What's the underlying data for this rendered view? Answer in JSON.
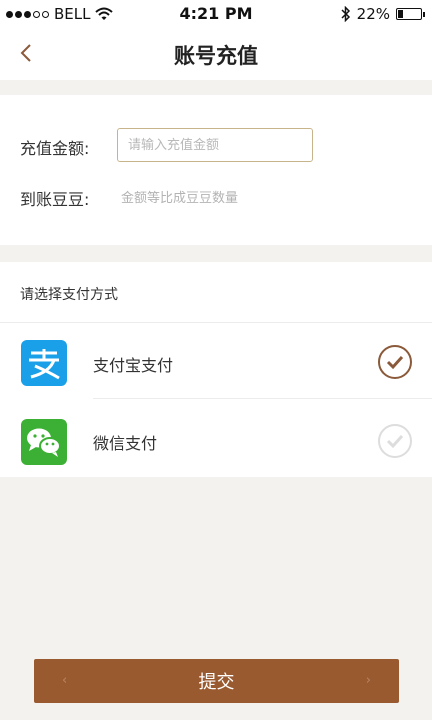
{
  "status_bar": {
    "carrier": "BELL",
    "time": "4:21 PM",
    "battery": "22%",
    "battery_level": 0.22,
    "signal_bars_filled": 3,
    "signal_bars_total": 5
  },
  "nav": {
    "title": "账号充值",
    "back_icon": "chevron-left-icon"
  },
  "recharge": {
    "amount_label": "充值金额:",
    "amount_placeholder": "请输入充值金额",
    "amount_value": "",
    "beans_label": "到账豆豆:",
    "beans_hint": "金额等比成豆豆数量"
  },
  "payment": {
    "header": "请选择支付方式",
    "options": [
      {
        "label": "支付宝支付",
        "icon": "alipay-icon",
        "selected": true,
        "icon_color": "#1aa0e8"
      },
      {
        "label": "微信支付",
        "icon": "wechat-icon",
        "selected": false,
        "icon_color": "#3cb034"
      }
    ]
  },
  "submit": {
    "label": "提交"
  },
  "colors": {
    "accent": "#9a5a30",
    "check_active": "#8a5a3a",
    "check_inactive": "#dddddd",
    "page_bg": "#f4f2ee"
  }
}
